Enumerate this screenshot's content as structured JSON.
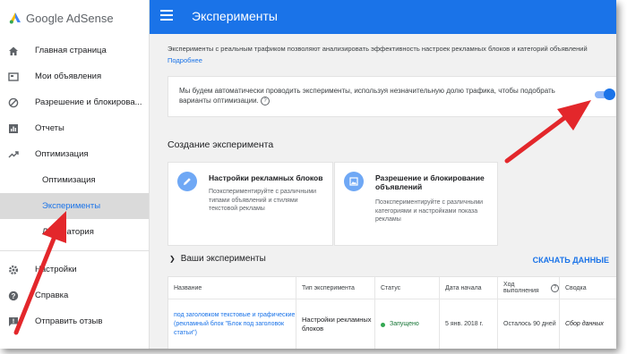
{
  "app": {
    "name": "Google AdSense"
  },
  "colors": {
    "accent": "#1a73e8",
    "arrow": "#e3272b",
    "status_ok": "#34a853"
  },
  "sidebar": {
    "items": [
      {
        "label": "Главная страница",
        "icon": "home-icon"
      },
      {
        "label": "Мои объявления",
        "icon": "ads-icon"
      },
      {
        "label": "Разрешение и блокирова...",
        "icon": "block-icon"
      },
      {
        "label": "Отчеты",
        "icon": "reports-icon"
      },
      {
        "label": "Оптимизация",
        "icon": "trending-icon"
      }
    ],
    "sub_items": [
      {
        "label": "Оптимизация"
      },
      {
        "label": "Эксперименты"
      },
      {
        "label": "Лаборатория"
      }
    ],
    "bottom_items": [
      {
        "label": "Настройки",
        "icon": "gear-icon"
      },
      {
        "label": "Справка",
        "icon": "help-icon"
      },
      {
        "label": "Отправить отзыв",
        "icon": "feedback-icon"
      }
    ]
  },
  "header": {
    "title": "Эксперименты"
  },
  "main": {
    "intro": "Эксперименты с реальным трафиком позволяют анализировать эффективность настроек рекламных блоков и категорий объявлений",
    "intro_link": "Подробнее",
    "auto_text": "Мы будем автоматически проводить эксперименты, используя незначительную долю трафика, чтобы подобрать варианты оптимизации.",
    "auto_toggle_on": true,
    "create_title": "Создание эксперимента",
    "cards": [
      {
        "title": "Настройки рекламных блоков",
        "desc": "Поэкспериментируйте с различными типами объявлений и стилями текстовой рекламы",
        "icon": "pencil-icon"
      },
      {
        "title": "Разрешение и блокирование объявлений",
        "desc": "Поэкспериментируйте с различными категориями и настройками показа рекламы",
        "icon": "image-icon"
      }
    ],
    "experiments_title": "Ваши эксперименты",
    "download_label": "СКАЧАТЬ ДАННЫЕ",
    "table": {
      "headers": [
        "Название",
        "Тип эксперимента",
        "Статус",
        "Дата начала",
        "Ход выполнения",
        "Сводка"
      ],
      "rows": [
        [
          "под заголовком текстовые и графические (рекламный блок \"Блок под заголовок статьи\")",
          "Настройки рекламных блоков",
          "Запущено",
          "5 янв. 2018 г.",
          "Осталось 90 дней",
          "Сбор данных"
        ]
      ]
    }
  }
}
